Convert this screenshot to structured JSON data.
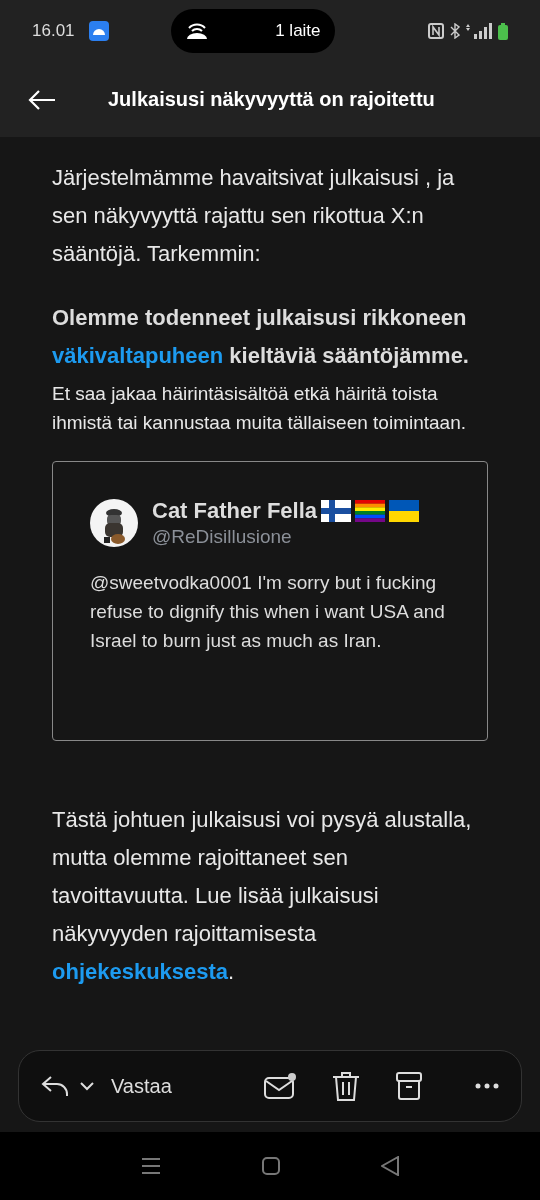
{
  "status_bar": {
    "time": "16.01",
    "hotspot": "1 laite"
  },
  "header": {
    "title": "Julkaisusi näkyvyyttä on rajoitettu"
  },
  "intro": "Järjestelmämme havaitsivat julkaisusi , ja sen näkyvyyttä rajattu sen rikottua X:n sääntöjä. Tarkemmin:",
  "violation": [
    {
      "kind": "plain",
      "text": "Olemme todenneet julkaisusi rikkoneen "
    },
    {
      "kind": "link",
      "text": "väkivaltapuheen"
    },
    {
      "kind": "plain",
      "text": " kieltäviä sääntöjämme."
    }
  ],
  "rule": "Et saa jakaa häirintäsisältöä etkä häiritä toista ihmistä tai kannustaa muita tällaiseen toimintaan.",
  "quoted_post": {
    "name": "Cat Father Fella",
    "handle": "@ReDisillusione",
    "text": "@sweetvodka0001 I'm sorry but i fucking refuse to dignify this when i want USA and Israel to burn just as much as Iran."
  },
  "outcome": [
    {
      "kind": "plain",
      "text": "Tästä johtuen julkaisusi voi pysyä alustalla, mutta olemme rajoittaneet sen tavoittavuutta. Lue lisää julkaisusi näkyvyyden rajoittamisesta "
    },
    {
      "kind": "link",
      "text": "ohjekeskuksesta"
    },
    {
      "kind": "plain",
      "text": "."
    }
  ],
  "toolbar": {
    "reply_label": "Vastaa"
  }
}
